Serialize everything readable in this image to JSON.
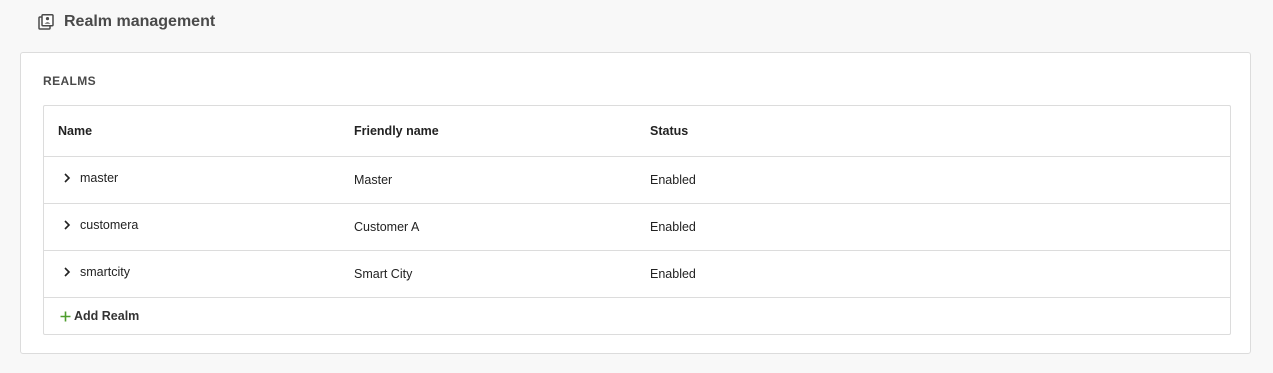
{
  "header": {
    "title": "Realm management",
    "icon": "realm-list-icon"
  },
  "panel": {
    "title": "REALMS"
  },
  "table": {
    "columns": [
      "Name",
      "Friendly name",
      "Status"
    ],
    "rows": [
      {
        "name": "master",
        "friendly_name": "Master",
        "status": "Enabled"
      },
      {
        "name": "customera",
        "friendly_name": "Customer A",
        "status": "Enabled"
      },
      {
        "name": "smartcity",
        "friendly_name": "Smart City",
        "status": "Enabled"
      }
    ]
  },
  "add_realm": {
    "label": "Add Realm",
    "icon": "plus-icon",
    "icon_color": "#4e9d2d"
  }
}
